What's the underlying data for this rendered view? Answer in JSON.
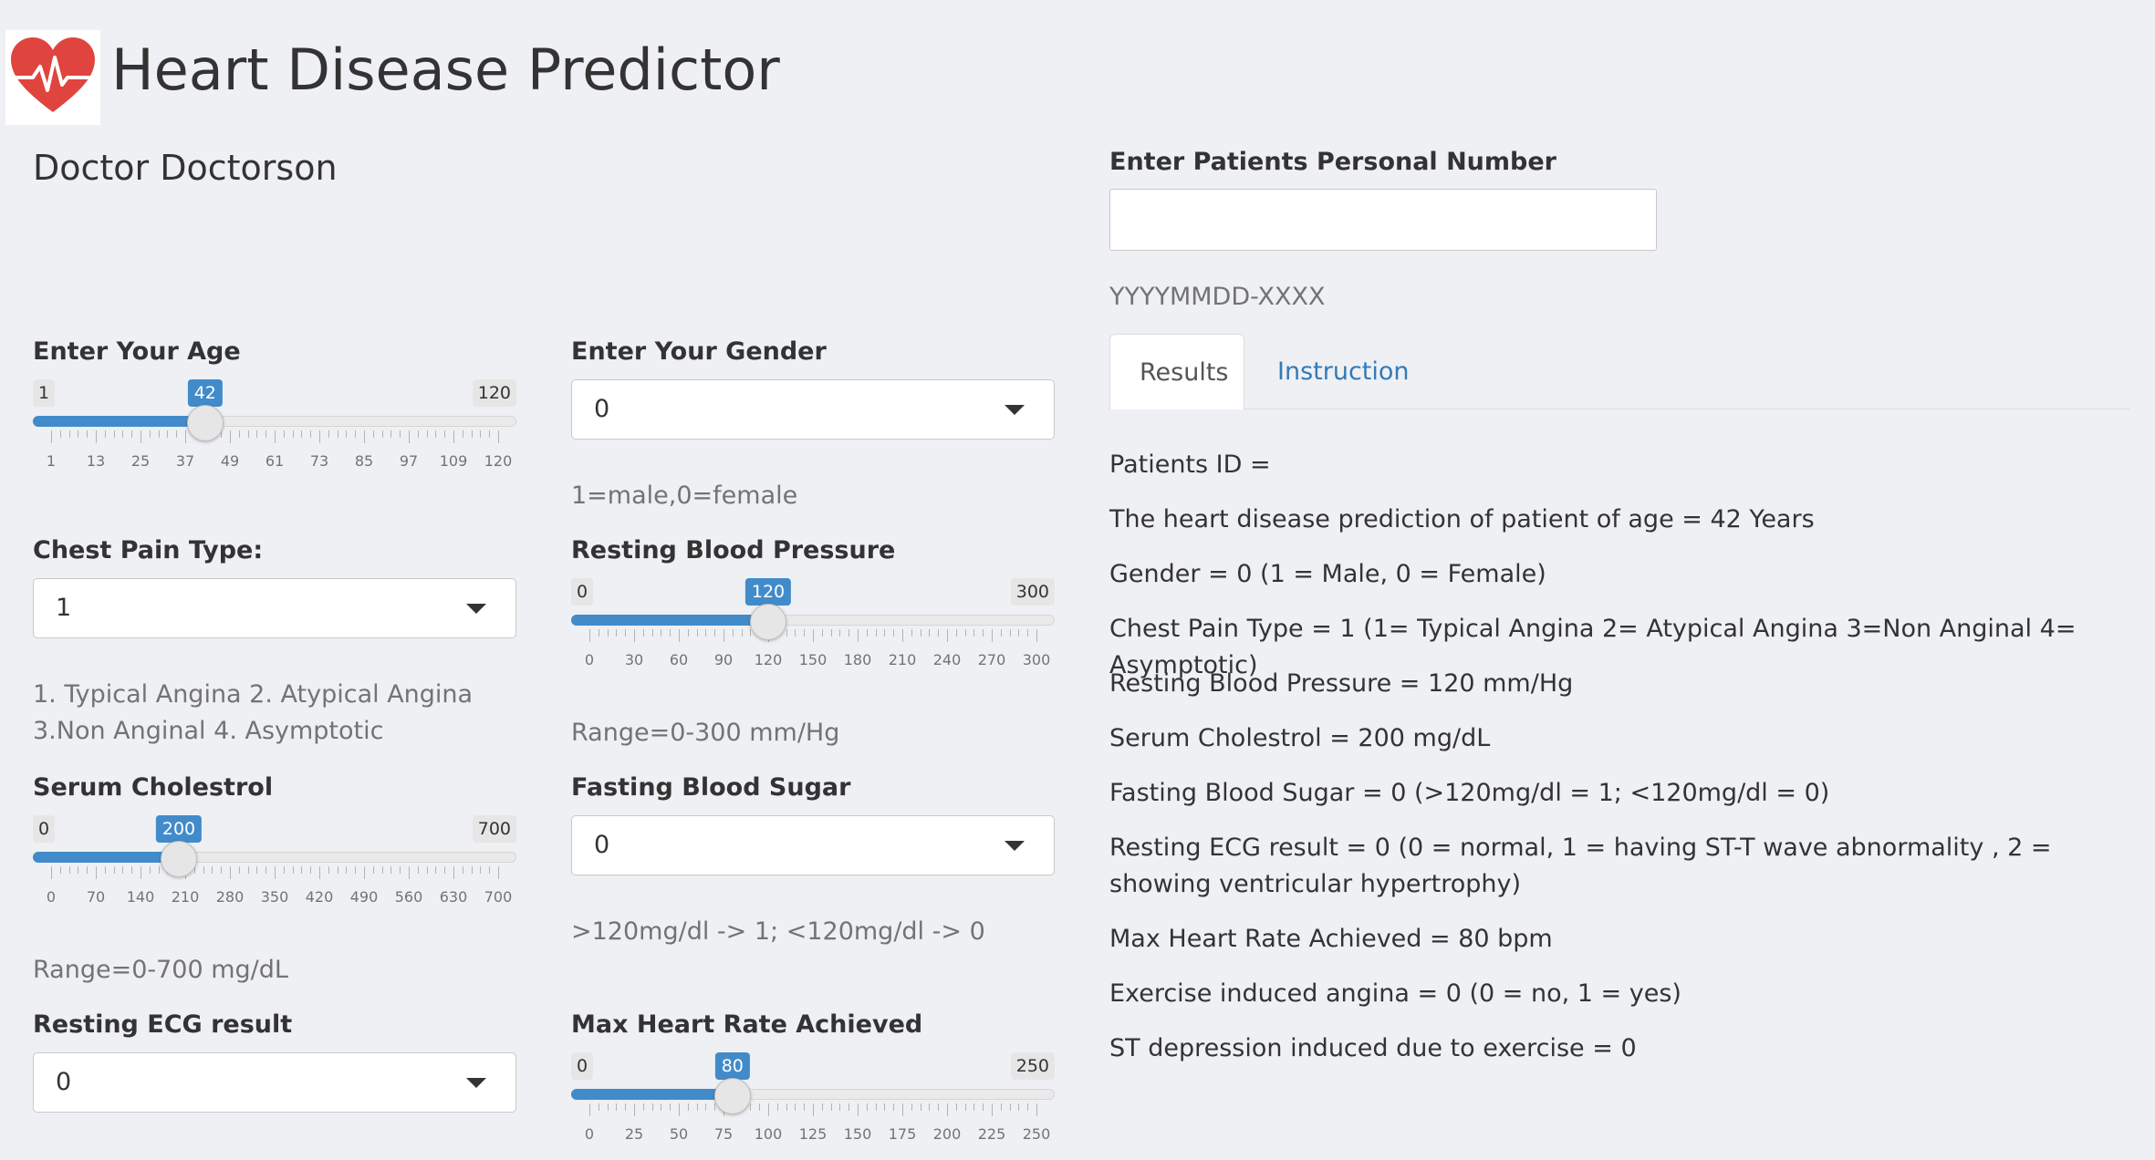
{
  "header": {
    "title": "Heart Disease Predictor",
    "logo_icon": "heart-pulse-icon",
    "logo_color": "#e0443e"
  },
  "doctor": {
    "name": "Doctor Doctorson"
  },
  "patient": {
    "label": "Enter Patients Personal Number",
    "value": "",
    "help": "YYYYMMDD-XXXX"
  },
  "age": {
    "label": "Enter Your Age",
    "min": 1,
    "max": 120,
    "value": 42,
    "min_label": "1",
    "max_label": "120",
    "value_label": "42",
    "ticks": [
      "1",
      "13",
      "25",
      "37",
      "49",
      "61",
      "73",
      "85",
      "97",
      "109",
      "120"
    ]
  },
  "gender": {
    "label": "Enter Your Gender",
    "value": "0",
    "help": "1=male,0=female"
  },
  "chest_pain": {
    "label": "Chest Pain Type:",
    "value": "1",
    "help": "1. Typical Angina 2. Atypical Angina 3.Non Anginal 4. Asymptotic"
  },
  "resting_bp": {
    "label": "Resting Blood Pressure",
    "min": 0,
    "max": 300,
    "value": 120,
    "min_label": "0",
    "max_label": "300",
    "value_label": "120",
    "ticks": [
      "0",
      "30",
      "60",
      "90",
      "120",
      "150",
      "180",
      "210",
      "240",
      "270",
      "300"
    ],
    "help": "Range=0-300 mm/Hg"
  },
  "cholestrol": {
    "label": "Serum Cholestrol",
    "min": 0,
    "max": 700,
    "value": 200,
    "min_label": "0",
    "max_label": "700",
    "value_label": "200",
    "ticks": [
      "0",
      "70",
      "140",
      "210",
      "280",
      "350",
      "420",
      "490",
      "560",
      "630",
      "700"
    ],
    "help": "Range=0-700 mg/dL"
  },
  "fbs": {
    "label": "Fasting Blood Sugar",
    "value": "0",
    "help": ">120mg/dl -> 1; <120mg/dl -> 0"
  },
  "ecg": {
    "label": "Resting ECG result",
    "value": "0"
  },
  "max_hr": {
    "label": "Max Heart Rate Achieved",
    "min": 0,
    "max": 250,
    "value": 80,
    "min_label": "0",
    "max_label": "250",
    "value_label": "80",
    "ticks": [
      "0",
      "25",
      "50",
      "75",
      "100",
      "125",
      "150",
      "175",
      "200",
      "225",
      "250"
    ]
  },
  "tabs": {
    "results": "Results",
    "instruction": "Instruction"
  },
  "results": [
    "Patients ID =",
    "The heart disease prediction of patient of age = 42 Years",
    "Gender = 0 (1 = Male, 0 = Female)",
    "Chest Pain Type = 1 (1= Typical Angina 2= Atypical Angina 3=Non Anginal 4= Asymptotic)",
    "Resting Blood Pressure = 120 mm/Hg",
    "Serum Cholestrol = 200 mg/dL",
    "Fasting Blood Sugar = 0 (>120mg/dl = 1; <120mg/dl = 0)",
    "Resting ECG result = 0 (0 = normal, 1 = having ST-T wave abnormality , 2 = showing ventricular hypertrophy)",
    "Max Heart Rate Achieved = 80 bpm",
    "Exercise induced angina = 0 (0 = no, 1 = yes)",
    "ST depression induced due to exercise = 0"
  ],
  "colors": {
    "accent": "#428bca",
    "link": "#337ab7",
    "background": "#eef0f3"
  }
}
